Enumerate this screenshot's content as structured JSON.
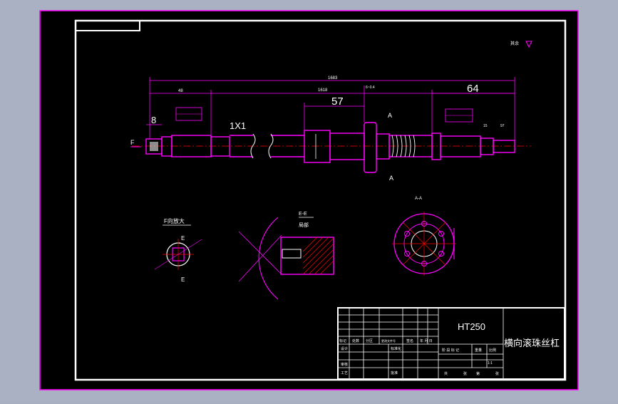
{
  "title_block": {
    "material": "HT250",
    "part_name": "横向滚珠丝杠",
    "scale": "1:1",
    "header_cells": [
      "标记",
      "处数",
      "分区",
      "更改文件号",
      "签名",
      "年 月 日"
    ],
    "row_labels": [
      "设计",
      "审核",
      "工艺"
    ],
    "mid_labels": [
      "标准化",
      "批准"
    ],
    "right_header": [
      "阶 段 标 记",
      "重量",
      "比例"
    ],
    "sheet_footer": [
      "共",
      "张",
      "第",
      "张"
    ]
  },
  "views": {
    "f_view_label": "F向放大",
    "section_label": "E-E",
    "section_sub": "局部",
    "aa_label": "A-A",
    "roughness_note": "其余"
  },
  "dimensions": {
    "overall": "1683",
    "left_len": "48",
    "mid_len": "1618",
    "d57": "57",
    "d64": "64",
    "d8": "8",
    "break_mark": "1X1",
    "small_dims": [
      "6~0.4",
      "15",
      "97",
      "19"
    ]
  },
  "labels": {
    "F": "F",
    "A": "A",
    "E": "E"
  },
  "colors": {
    "frame": "#ffffff",
    "drawing": "#ff00ff",
    "dimension": "#ff00ff",
    "center": "#ff0000",
    "text": "#ffffff",
    "background": "#000000"
  }
}
